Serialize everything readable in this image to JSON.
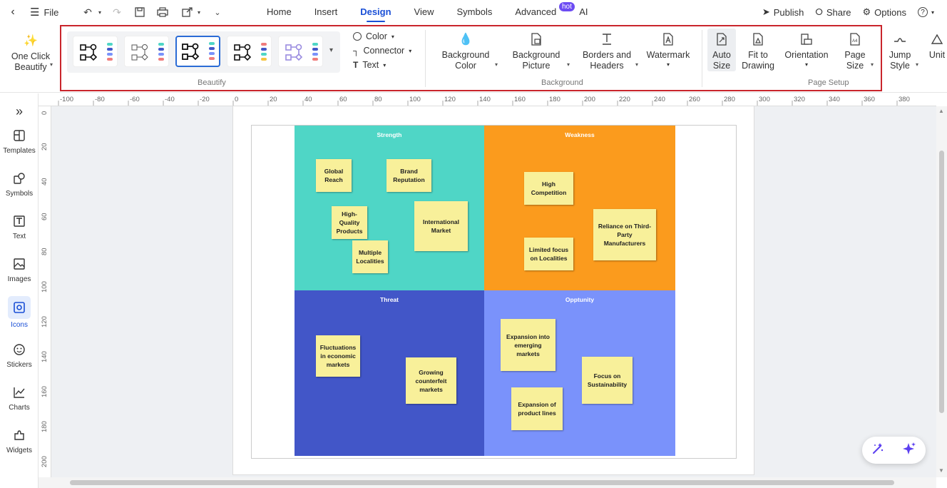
{
  "titlebar": {
    "file_label": "File",
    "tabs": [
      {
        "label": "Home"
      },
      {
        "label": "Insert"
      },
      {
        "label": "Design"
      },
      {
        "label": "View"
      },
      {
        "label": "Symbols"
      },
      {
        "label": "Advanced"
      },
      {
        "label": "AI"
      }
    ],
    "hot_badge": "hot",
    "publish_label": "Publish",
    "share_label": "Share",
    "options_label": "Options",
    "help_label": "?"
  },
  "ribbon": {
    "one_click_beautify": "One Click\nBeautify",
    "color": "Color",
    "connector": "Connector",
    "text": "Text",
    "background_color": "Background\nColor",
    "background_picture": "Background\nPicture",
    "borders_headers": "Borders and\nHeaders",
    "watermark": "Watermark",
    "auto_size": "Auto\nSize",
    "fit_to_drawing": "Fit to\nDrawing",
    "orientation": "Orientation",
    "page_size": "Page\nSize",
    "jump_style": "Jump\nStyle",
    "unit": "Unit",
    "group_beautify": "Beautify",
    "group_background": "Background",
    "group_page_setup": "Page Setup"
  },
  "sidebar": {
    "items": [
      {
        "label": "Templates",
        "icon": "templates-icon"
      },
      {
        "label": "Symbols",
        "icon": "symbols-icon"
      },
      {
        "label": "Text",
        "icon": "text-icon"
      },
      {
        "label": "Images",
        "icon": "images-icon"
      },
      {
        "label": "Icons",
        "icon": "icons-icon"
      },
      {
        "label": "Stickers",
        "icon": "stickers-icon"
      },
      {
        "label": "Charts",
        "icon": "charts-icon"
      },
      {
        "label": "Widgets",
        "icon": "widgets-icon"
      }
    ]
  },
  "ruler": {
    "top": [
      "-100",
      "-80",
      "-60",
      "-40",
      "-20",
      "0",
      "20",
      "40",
      "60",
      "80",
      "100",
      "120",
      "140",
      "160",
      "180",
      "200",
      "220",
      "240",
      "260",
      "280",
      "300",
      "320",
      "340",
      "360",
      "380"
    ],
    "left": [
      "0",
      "20",
      "40",
      "60",
      "80",
      "100",
      "120",
      "140",
      "160",
      "180",
      "200"
    ]
  },
  "swot": {
    "strength": {
      "title": "Strength",
      "color": "#4fd6c6",
      "notes": [
        "Global\nReach",
        "Brand\nReputation",
        "High-\nQuality\nProducts",
        "International\nMarket",
        "Multiple\nLocalities"
      ]
    },
    "weakness": {
      "title": "Weakness",
      "color": "#fb9b1d",
      "notes": [
        "High\nCompetition",
        "Reliance on Third-\nParty\nManufacturers",
        "Limited focus\non Localities"
      ]
    },
    "threat": {
      "title": "Threat",
      "color": "#4256c8",
      "notes": [
        "Fluctuations\nin economic\nmarkets",
        "Growing\ncounterfeit\nmarkets"
      ]
    },
    "opportunity": {
      "title": "Opptunity",
      "color": "#7a92fb",
      "notes": [
        "Expansion into\nemerging\nmarkets",
        "Focus on\nSustainability",
        "Expansion of\nproduct lines"
      ]
    }
  },
  "colors": {
    "accent": "#1a4fd6",
    "highlight": "#c9252c",
    "hot_badge": "#6c4cf3"
  }
}
